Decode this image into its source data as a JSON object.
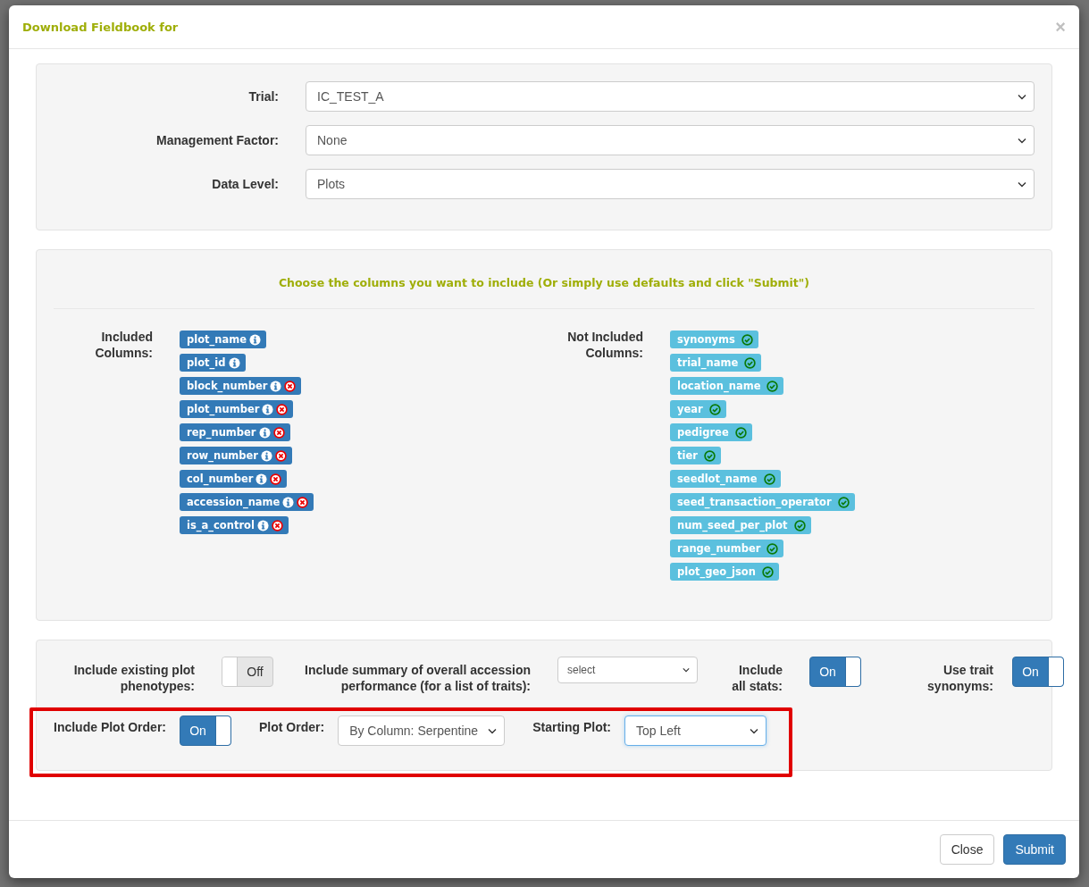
{
  "modal": {
    "title": "Download Fieldbook for",
    "close": "×"
  },
  "selects": [
    {
      "label": "Trial:",
      "value": "IC_TEST_A"
    },
    {
      "label": "Management Factor:",
      "value": "None"
    },
    {
      "label": "Data Level:",
      "value": "Plots"
    }
  ],
  "columns_panel": {
    "heading": "Choose the columns you want to include (Or simply use defaults and click \"Submit\")",
    "included": {
      "label": "Included Columns:",
      "items": [
        {
          "name": "plot_name",
          "removable": false
        },
        {
          "name": "plot_id",
          "removable": false
        },
        {
          "name": "block_number",
          "removable": true
        },
        {
          "name": "plot_number",
          "removable": true
        },
        {
          "name": "rep_number",
          "removable": true
        },
        {
          "name": "row_number",
          "removable": true
        },
        {
          "name": "col_number",
          "removable": true
        },
        {
          "name": "accession_name",
          "removable": true
        },
        {
          "name": "is_a_control",
          "removable": true
        }
      ]
    },
    "not_included": {
      "label": "Not Included Columns:",
      "items": [
        {
          "name": "synonyms"
        },
        {
          "name": "trial_name"
        },
        {
          "name": "location_name"
        },
        {
          "name": "year"
        },
        {
          "name": "pedigree"
        },
        {
          "name": "tier"
        },
        {
          "name": "seedlot_name"
        },
        {
          "name": "seed_transaction_operator"
        },
        {
          "name": "num_seed_per_plot"
        },
        {
          "name": "range_number"
        },
        {
          "name": "plot_geo_json"
        }
      ]
    }
  },
  "options": [
    {
      "kind": "toggle",
      "label": "Include existing plot phenotypes:",
      "on": false,
      "text": "Off"
    },
    {
      "kind": "select",
      "label": "Include summary of overall accession performance (for a list of traits):",
      "value": "select"
    },
    {
      "kind": "toggle",
      "label": "Include all stats:",
      "on": true,
      "text": "On"
    },
    {
      "kind": "toggle",
      "label": "Use trait synonyms:",
      "on": true,
      "text": "On"
    }
  ],
  "plot_order": {
    "highlighted": true,
    "items": [
      {
        "kind": "toggle",
        "label": "Include Plot Order:",
        "on": true,
        "text": "On"
      },
      {
        "kind": "select",
        "label": "Plot Order:",
        "value": "By Column: Serpentine",
        "focused": false
      },
      {
        "kind": "select",
        "label": "Starting Plot:",
        "value": "Top Left",
        "focused": true
      }
    ]
  },
  "buttons": [
    {
      "label": "Close",
      "kind": "default"
    },
    {
      "label": "Submit",
      "kind": "primary"
    }
  ]
}
